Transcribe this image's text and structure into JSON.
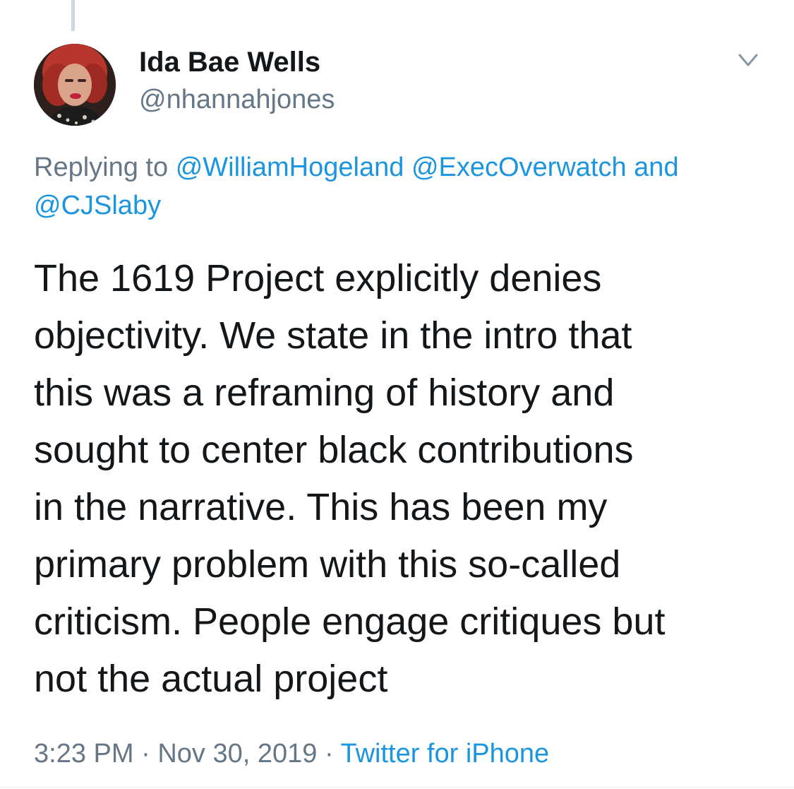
{
  "tweet": {
    "author": {
      "display_name": "Ida Bae Wells",
      "handle": "@nhannahjones"
    },
    "reply": {
      "prefix": "Replying to",
      "mentions": [
        "@WilliamHogeland",
        "@ExecOverwatch"
      ],
      "conjunction": "and",
      "last_mention": "@CJSlaby"
    },
    "text": "The 1619 Project explicitly denies\nobjectivity. We state in the intro that\nthis was a reframing of history and\nsought to center black contributions\nin the narrative. This has been my\nprimary problem with this so-called\ncriticism. People engage critiques but\nnot the actual project",
    "time": "3:23 PM",
    "date": "Nov 30, 2019",
    "separator": "·",
    "source": "Twitter for iPhone"
  },
  "icons": {
    "menu": "chevron-down-icon",
    "avatar": "profile-photo"
  },
  "colors": {
    "text": "#14171a",
    "secondary": "#657786",
    "link": "#1b95e0",
    "thread_line": "#cfd6dc"
  }
}
